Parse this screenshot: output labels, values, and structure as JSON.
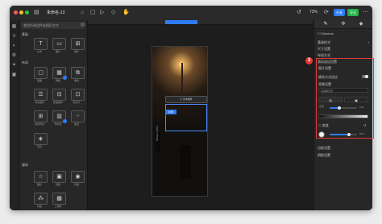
{
  "titlebar": {
    "title": "未命名-13",
    "zoom": "73%",
    "share_label": "分享",
    "export_label": "导出"
  },
  "colors": {
    "accent": "#2f7cf6",
    "export_green": "#24b14b",
    "highlight_red": "#e53935"
  },
  "left_panel": {
    "header_placeholder": "查找所有组件或图形文字",
    "section_basic": "基础",
    "section_layout": "布局",
    "section_media": "媒体",
    "basic_items": [
      {
        "icon": "text-icon",
        "label": "文本"
      },
      {
        "icon": "image-icon",
        "label": "图片"
      },
      {
        "icon": "shape-icon",
        "label": "组件"
      }
    ],
    "layout_items": [
      {
        "icon": "container-icon",
        "label": "容器"
      },
      {
        "icon": "grid-icon",
        "label": "网格"
      },
      {
        "icon": "stack-icon",
        "label": "堆叠"
      },
      {
        "icon": "list-icon",
        "label": "列表组件"
      },
      {
        "icon": "carousel-icon",
        "label": "轮播组件"
      },
      {
        "icon": "tabs-icon",
        "label": "选项卡"
      },
      {
        "icon": "scroll-icon",
        "label": "滚动列表"
      },
      {
        "icon": "masonry-icon",
        "label": "瀑布流"
      },
      {
        "icon": "gallery-icon",
        "label": "画廊"
      },
      {
        "icon": "diamond-icon",
        "label": "形状"
      }
    ],
    "media_items": [
      {
        "icon": "star-icon",
        "label": "图标"
      },
      {
        "icon": "video-icon",
        "label": "视频"
      },
      {
        "icon": "audio-icon",
        "label": "音频"
      },
      {
        "icon": "lottie-icon",
        "label": "动画"
      },
      {
        "icon": "qr-icon",
        "label": "二维码"
      }
    ]
  },
  "canvas": {
    "selection_chip": "◎ 文本组件",
    "selection_label": "标题",
    "vertical_caption": "iPhone 14 Pro"
  },
  "right_panel": {
    "tabs": [
      "brush-icon",
      "move-icon",
      "component-icon"
    ],
    "title": "Visionos",
    "rows": [
      "基础样式",
      "尺寸设置",
      "布局方式",
      "滚动溢出设置"
    ],
    "highlight": {
      "callout": "3",
      "section_title": "图片设置",
      "toggle_label": "填充方式适应",
      "subsection": "背景设置",
      "field_placeholder": "请选择背景",
      "blend_left": "正常",
      "blend_right": "不透明",
      "opacity_value": "100",
      "fill_label": "渐变",
      "fill_value": "50%"
    },
    "bottom_rows": [
      "边框设置",
      "阴影设置"
    ]
  }
}
